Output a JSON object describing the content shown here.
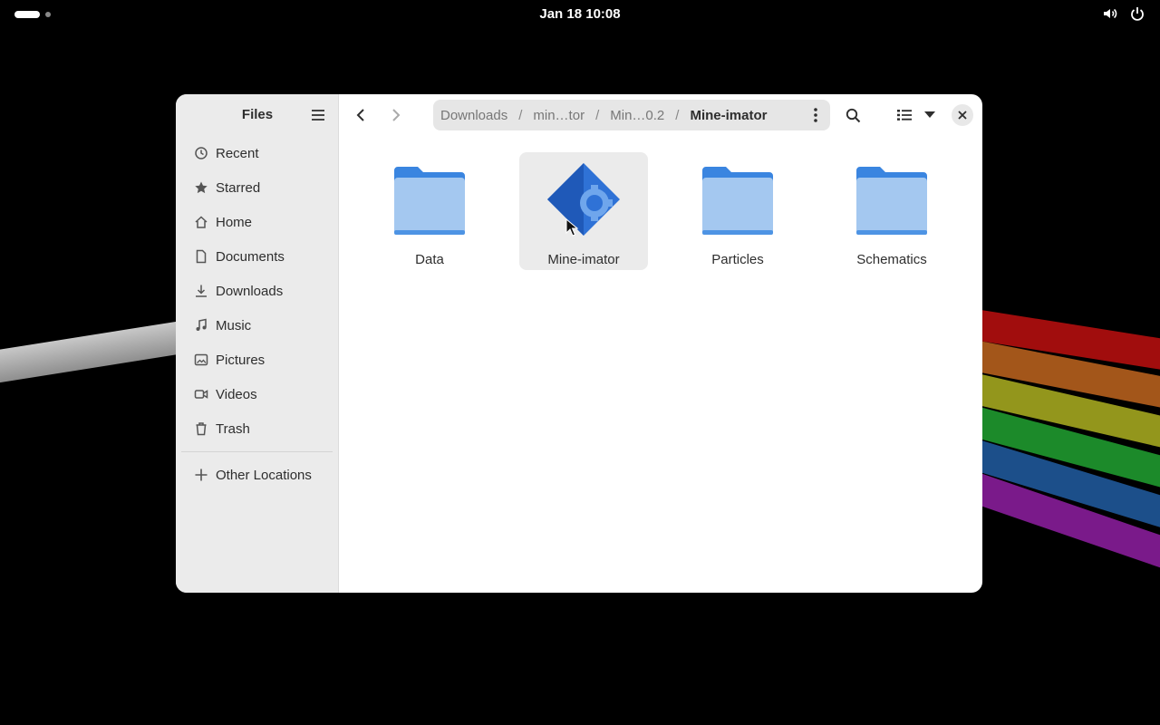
{
  "topbar": {
    "clock": "Jan 18  10:08",
    "icons": [
      "volume-icon",
      "power-icon"
    ]
  },
  "sidebar": {
    "title": "Files",
    "items": [
      {
        "label": "Recent",
        "icon": "clock-icon"
      },
      {
        "label": "Starred",
        "icon": "star-icon"
      },
      {
        "label": "Home",
        "icon": "home-icon"
      },
      {
        "label": "Documents",
        "icon": "document-icon"
      },
      {
        "label": "Downloads",
        "icon": "download-icon"
      },
      {
        "label": "Music",
        "icon": "music-icon"
      },
      {
        "label": "Pictures",
        "icon": "picture-icon"
      },
      {
        "label": "Videos",
        "icon": "video-icon"
      },
      {
        "label": "Trash",
        "icon": "trash-icon"
      }
    ],
    "other": {
      "label": "Other Locations",
      "icon": "plus-icon"
    }
  },
  "header": {
    "breadcrumbs": [
      "Downloads",
      "min…tor",
      "Min…0.2",
      "Mine-imator"
    ]
  },
  "files": [
    {
      "name": "Data",
      "type": "folder",
      "selected": false
    },
    {
      "name": "Mine-imator",
      "type": "executable",
      "selected": true
    },
    {
      "name": "Particles",
      "type": "folder",
      "selected": false
    },
    {
      "name": "Schematics",
      "type": "folder",
      "selected": false
    }
  ],
  "colors": {
    "folder_back": "#3a85e0",
    "folder_front": "#a4c8f0",
    "app_icon": "#2f72d6",
    "sidebar_bg": "#ebebeb",
    "accent": "#3584e4"
  }
}
